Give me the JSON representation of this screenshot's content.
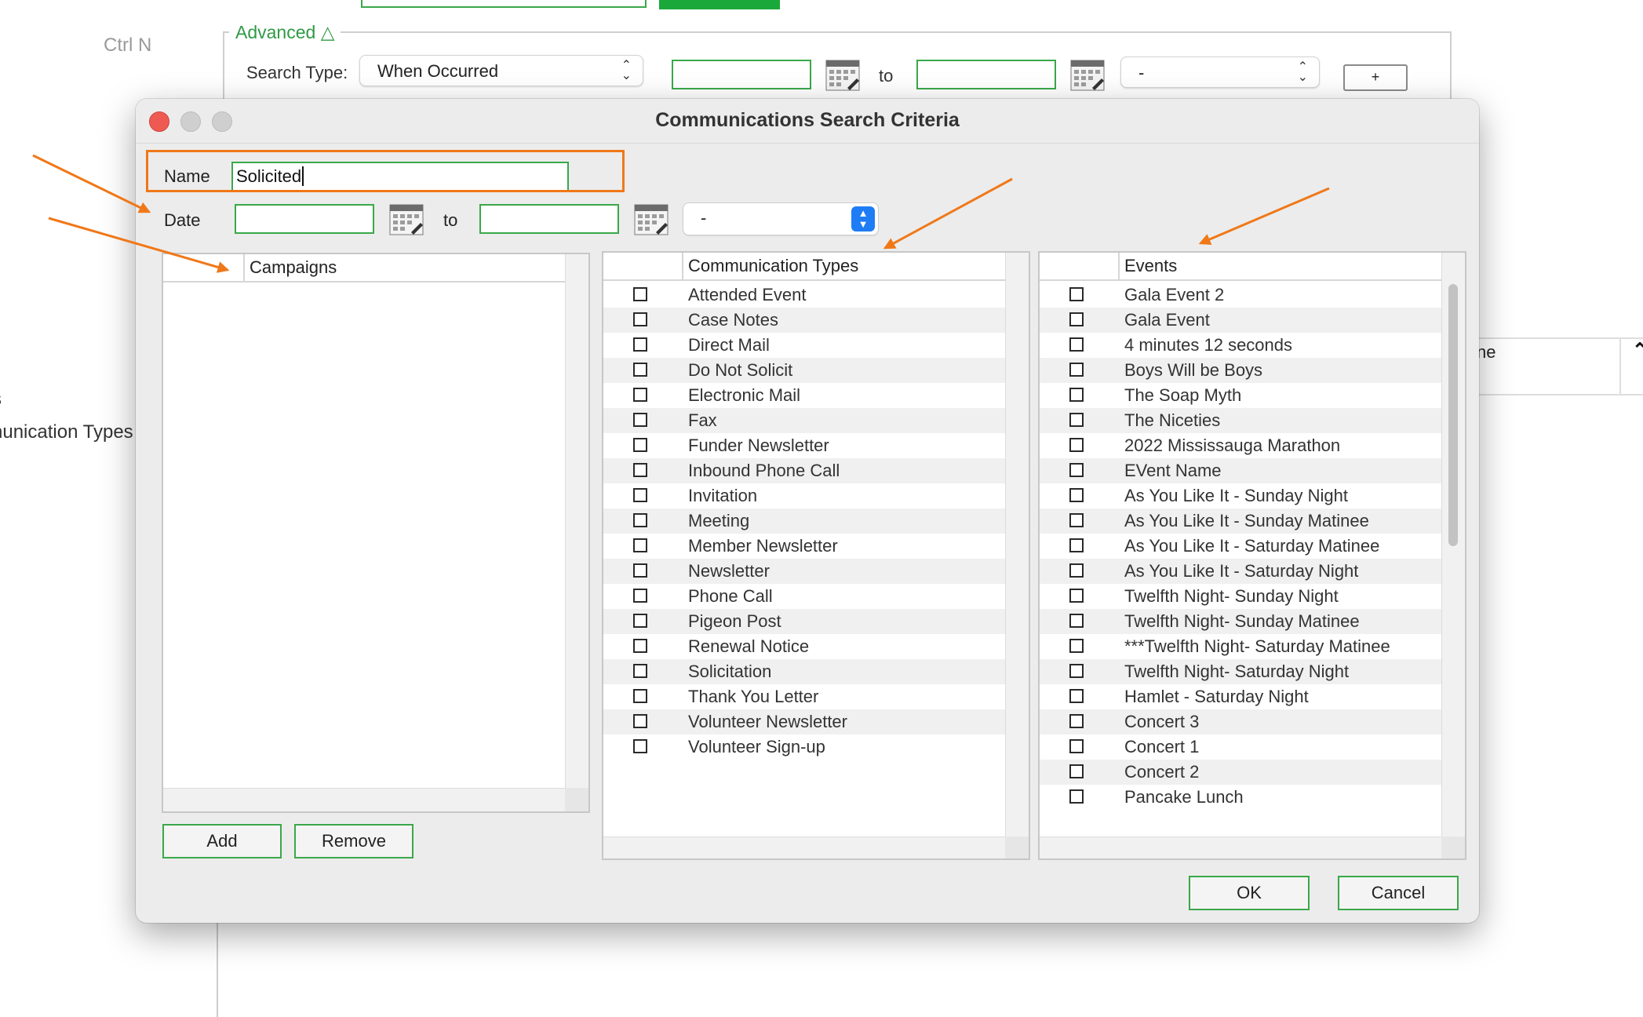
{
  "background": {
    "shortcut": "Ctrl N",
    "advanced_label": "Advanced △",
    "search_type_label": "Search Type:",
    "search_type_value": "When Occurred",
    "to_label": "to",
    "range_value": "-",
    "plus_label": "+",
    "right_panel_text": "ne",
    "sidebar_items": [
      "s",
      "nunication Types"
    ]
  },
  "dialog": {
    "title": "Communications Search Criteria",
    "name_label": "Name",
    "name_value": "Solicited",
    "date_label": "Date",
    "to_label": "to",
    "range_value": "-",
    "campaigns_header": "Campaigns",
    "add_label": "Add",
    "remove_label": "Remove",
    "ok_label": "OK",
    "cancel_label": "Cancel",
    "communication_types_header": "Communication Types",
    "communication_types": [
      "Attended Event",
      "Case Notes",
      "Direct Mail",
      "Do Not Solicit",
      "Electronic Mail",
      "Fax",
      "Funder Newsletter",
      "Inbound Phone Call",
      "Invitation",
      "Meeting",
      "Member Newsletter",
      "Newsletter",
      "Phone Call",
      "Pigeon Post",
      "Renewal Notice",
      "Solicitation",
      "Thank You Letter",
      "Volunteer Newsletter",
      "Volunteer Sign-up"
    ],
    "events_header": "Events",
    "events": [
      "Gala Event 2",
      "Gala Event",
      "4 minutes 12 seconds",
      "Boys Will be Boys",
      "The Soap Myth",
      "The Niceties",
      "2022 Mississauga Marathon",
      "EVent Name",
      "As You Like It - Sunday Night",
      "As You Like It - Sunday Matinee",
      "As You Like It - Saturday Matinee",
      "As You Like It - Saturday Night",
      "Twelfth Night- Sunday Night",
      "Twelfth Night- Sunday Matinee",
      "***Twelfth Night- Saturday Matinee",
      "Twelfth Night- Saturday Night",
      "Hamlet - Saturday Night",
      "Concert 3",
      "Concert 1",
      "Concert 2",
      "Pancake Lunch"
    ]
  },
  "colors": {
    "accent_green": "#3aa84a",
    "annotation_orange": "#f07818",
    "stepper_blue": "#1e7cf5",
    "close_red": "#ee5a52"
  }
}
